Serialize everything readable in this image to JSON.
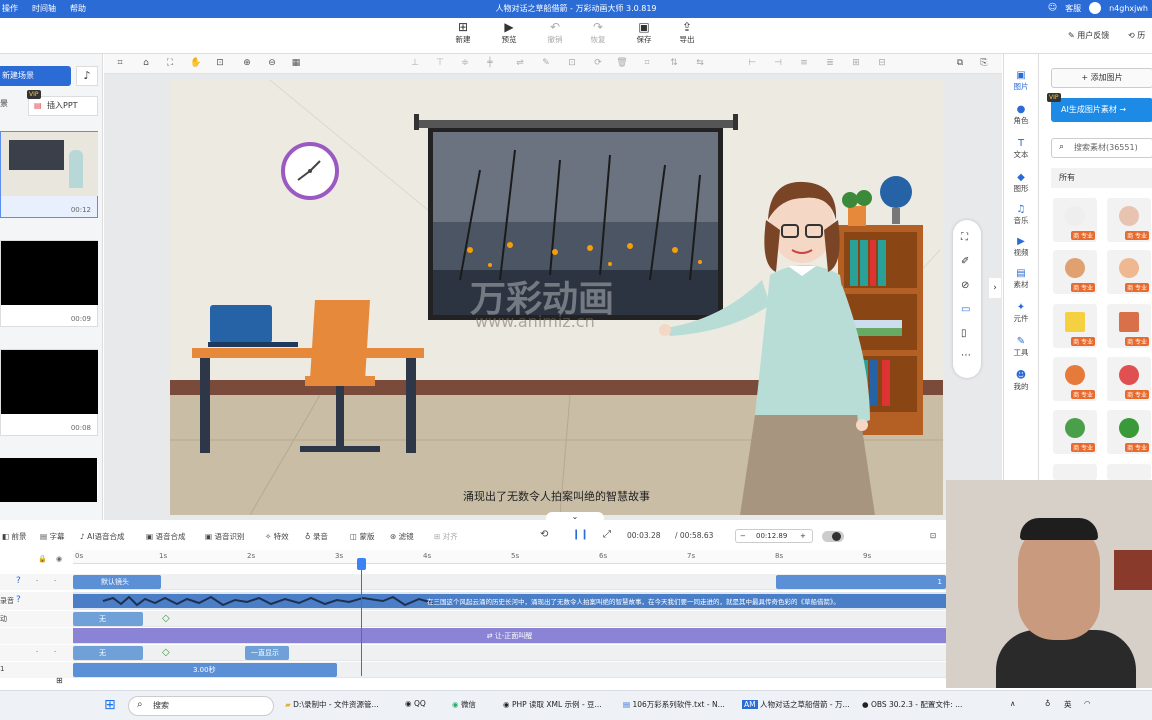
{
  "titlebar": {
    "menu": [
      "操作",
      "时间轴",
      "帮助"
    ],
    "title": "人物对话之草船借箭 - 万彩动画大师 3.0.819",
    "service": "客服",
    "user": "n4ghxjwh"
  },
  "toolbar": {
    "new": "新建",
    "preview": "预览",
    "undo": "撤销",
    "redo": "恢复",
    "save": "保存",
    "export": "导出",
    "feedback": "用户反馈",
    "history": "历"
  },
  "left": {
    "new_scene": "新建场景",
    "insert_ppt": "插入PPT",
    "vip": "VIP",
    "scene_label_short": "景",
    "scenes": [
      {
        "duration": "00:12"
      },
      {
        "duration": "00:09"
      },
      {
        "duration": "00:08"
      }
    ]
  },
  "canvas": {
    "watermark_cn": "万彩动画",
    "watermark_url": "www.animiz.cn",
    "subtitle": "涌现出了无数令人拍案叫绝的智慧故事"
  },
  "rightrail": {
    "items": [
      "图片",
      "角色",
      "文本",
      "图形",
      "音乐",
      "视频",
      "素材",
      "元件",
      "工具",
      "我的"
    ]
  },
  "assets": {
    "add_image": "+ 添加图片",
    "ai_button": "AI生成图片素材 →",
    "vip": "VIP",
    "search_placeholder": "搜索素材(36551)",
    "filter": "所有",
    "tag": "商 专业"
  },
  "timeline": {
    "tools": [
      "前景",
      "字幕",
      "AI语音合成",
      "语音合成",
      "语音识别",
      "特效",
      "录音",
      "蒙版",
      "滤镜",
      "对齐"
    ],
    "current_time": "00:03.28",
    "total_time": "/ 00:58.63",
    "zoom_time": "00:12.89",
    "ruler": [
      "0s",
      "1s",
      "2s",
      "3s",
      "4s",
      "5s",
      "6s",
      "7s",
      "8s",
      "9s"
    ],
    "track_labels": [
      "",
      "录音",
      "动",
      "",
      "",
      "1"
    ],
    "clip_camera": "默认镜头",
    "clip_camera_end": "1",
    "audio_text": "在三国这个风起云涌的历史长河中，涌现出了无数令人拍案叫绝的智慧故事，在今天我们要一同走进的，就是其中最具传奇色彩的《草船借箭》。",
    "clip_none1": "无",
    "clip_transition": "⇄ 让-正面叫醒",
    "clip_none2": "无",
    "clip_always": "一直显示",
    "clip_duration": "3.00秒"
  },
  "taskbar": {
    "search": "搜索",
    "items": [
      "D:\\录制中 - 文件资源管...",
      "QQ",
      "微信",
      "PHP 读取 XML 示例 - 豆...",
      "106万彩系列软件.txt - N...",
      "人物对话之草船借箭 - 万...",
      "OBS 30.2.3 - 配置文件: ..."
    ],
    "ime": "英",
    "time_hidden": ""
  }
}
